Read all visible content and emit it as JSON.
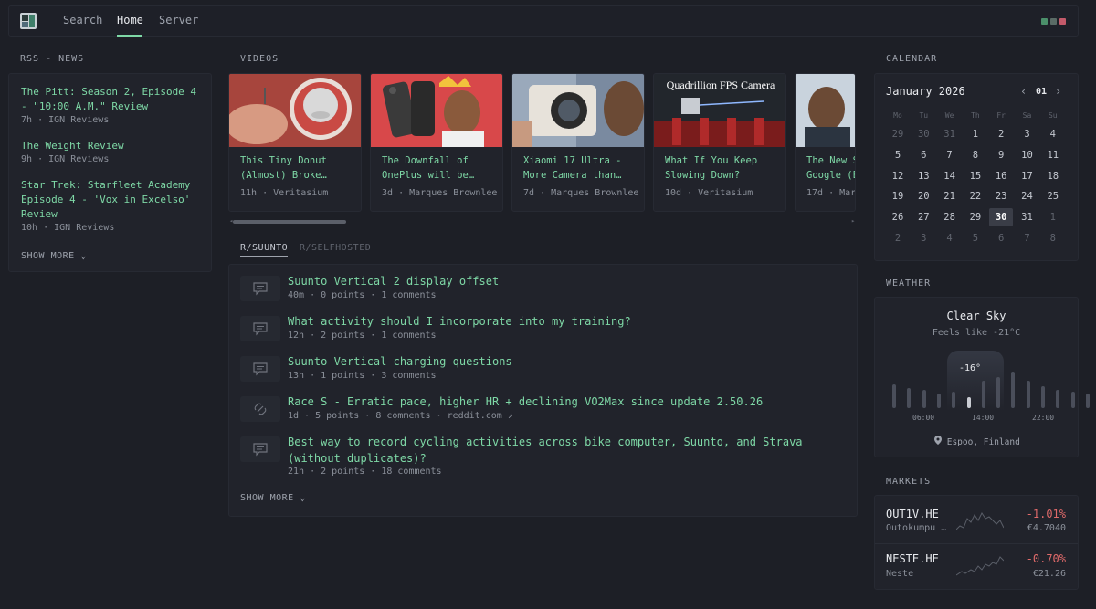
{
  "nav": {
    "items": [
      {
        "label": "Search"
      },
      {
        "label": "Home"
      },
      {
        "label": "Server"
      }
    ],
    "active": "Home",
    "theme_colors": [
      "#4b8f6a",
      "#5a6b66",
      "#c45a6a"
    ]
  },
  "rss": {
    "title": "RSS - NEWS",
    "items": [
      {
        "title": "The Pitt: Season 2, Episode 4 - \"10:00 A.M.\" Review",
        "age": "7h",
        "source": "IGN Reviews"
      },
      {
        "title": "The Weight Review",
        "age": "9h",
        "source": "IGN Reviews"
      },
      {
        "title": "Star Trek: Starfleet Academy Episode 4 - 'Vox in Excelso' Review",
        "age": "10h",
        "source": "IGN Reviews"
      }
    ],
    "show_more": "SHOW MORE"
  },
  "videos": {
    "title": "VIDEOS",
    "items": [
      {
        "title": "This Tiny Donut\n(Almost) Broke…",
        "age": "11h",
        "channel": "Veritasium"
      },
      {
        "title": "The Downfall of\nOnePlus will be…",
        "age": "3d",
        "channel": "Marques Brownlee"
      },
      {
        "title": "Xiaomi 17 Ultra -\nMore Camera than…",
        "age": "7d",
        "channel": "Marques Brownlee"
      },
      {
        "title": "What If You Keep\nSlowing Down?",
        "age": "10d",
        "channel": "Veritasium",
        "thumb_text": "Quadrillion FPS Camera"
      },
      {
        "title": "The New S\nGoogle (E",
        "age": "17d",
        "channel": "Marq"
      }
    ]
  },
  "reddit": {
    "tabs": [
      "R/SUUNTO",
      "R/SELFHOSTED"
    ],
    "active_tab": "R/SUUNTO",
    "posts": [
      {
        "title": "Suunto Vertical 2 display offset",
        "meta": "40m · 0 points · 1 comments",
        "icon": "comment-icon"
      },
      {
        "title": "What activity should I incorporate into my training?",
        "meta": "12h · 2 points · 1 comments",
        "icon": "comment-icon"
      },
      {
        "title": "Suunto Vertical charging questions",
        "meta": "13h · 1 points · 3 comments",
        "icon": "comment-icon"
      },
      {
        "title": "Race S - Erratic pace, higher HR + declining VO2Max since update 2.50.26",
        "meta": "1d · 5 points · 8 comments · reddit.com ↗",
        "icon": "link-icon"
      },
      {
        "title": "Best way to record cycling activities across bike computer, Suunto, and Strava (without duplicates)?",
        "meta": "21h · 2 points · 18 comments",
        "icon": "comment-icon"
      }
    ],
    "show_more": "SHOW MORE"
  },
  "calendar": {
    "title": "CALENDAR",
    "month": "January 2026",
    "month_number": "01",
    "weekdays": [
      "Mo",
      "Tu",
      "We",
      "Th",
      "Fr",
      "Sa",
      "Su"
    ],
    "weeks": [
      [
        "29",
        "30",
        "31",
        "1",
        "2",
        "3",
        "4"
      ],
      [
        "5",
        "6",
        "7",
        "8",
        "9",
        "10",
        "11"
      ],
      [
        "12",
        "13",
        "14",
        "15",
        "16",
        "17",
        "18"
      ],
      [
        "19",
        "20",
        "21",
        "22",
        "23",
        "24",
        "25"
      ],
      [
        "26",
        "27",
        "28",
        "29",
        "30",
        "31",
        "1"
      ],
      [
        "2",
        "3",
        "4",
        "5",
        "6",
        "7",
        "8"
      ]
    ],
    "today": "30"
  },
  "weather": {
    "title": "WEATHER",
    "condition": "Clear Sky",
    "feels_like": "Feels like -21°C",
    "current_temp": "-16°",
    "times": [
      "06:00",
      "14:00",
      "22:00"
    ],
    "location": "Espoo, Finland"
  },
  "markets": {
    "title": "MARKETS",
    "items": [
      {
        "symbol": "OUT1V.HE",
        "name": "Outokumpu …",
        "change": "-1.01%",
        "price": "€4.7040"
      },
      {
        "symbol": "NESTE.HE",
        "name": "Neste",
        "change": "-0.70%",
        "price": "€21.26"
      }
    ],
    "negative_color": "#e06a6a"
  }
}
